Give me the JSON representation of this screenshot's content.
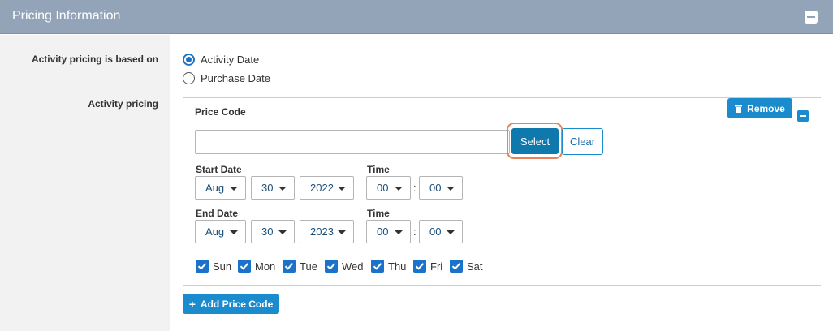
{
  "panel": {
    "title": "Pricing Information"
  },
  "fields": {
    "pricing_basis_label": "Activity pricing is based on",
    "activity_pricing_label": "Activity pricing"
  },
  "pricing_basis": {
    "options": [
      {
        "label": "Activity Date",
        "checked": true
      },
      {
        "label": "Purchase Date",
        "checked": false
      }
    ]
  },
  "price_code": {
    "label": "Price Code",
    "value": "",
    "select_label": "Select",
    "clear_label": "Clear",
    "remove_label": "Remove"
  },
  "start": {
    "date_label": "Start Date",
    "time_label": "Time",
    "month": "Aug",
    "day": "30",
    "year": "2022",
    "hour": "00",
    "minute": "00"
  },
  "end": {
    "date_label": "End Date",
    "time_label": "Time",
    "month": "Aug",
    "day": "30",
    "year": "2023",
    "hour": "00",
    "minute": "00"
  },
  "time_separator": ":",
  "days": [
    {
      "label": "Sun",
      "checked": true
    },
    {
      "label": "Mon",
      "checked": true
    },
    {
      "label": "Tue",
      "checked": true
    },
    {
      "label": "Wed",
      "checked": true
    },
    {
      "label": "Thu",
      "checked": true
    },
    {
      "label": "Fri",
      "checked": true
    },
    {
      "label": "Sat",
      "checked": true
    }
  ],
  "add_price_code_label": "Add Price Code",
  "icons": {
    "collapse": "minus-square-icon",
    "remove": "trash-icon",
    "add": "plus-icon",
    "dropdown": "caret-down-icon",
    "checkbox": "checkmark-icon"
  },
  "colors": {
    "header": "#93a3b8",
    "primary": "#1a8ccd",
    "highlight": "#e9825a"
  }
}
